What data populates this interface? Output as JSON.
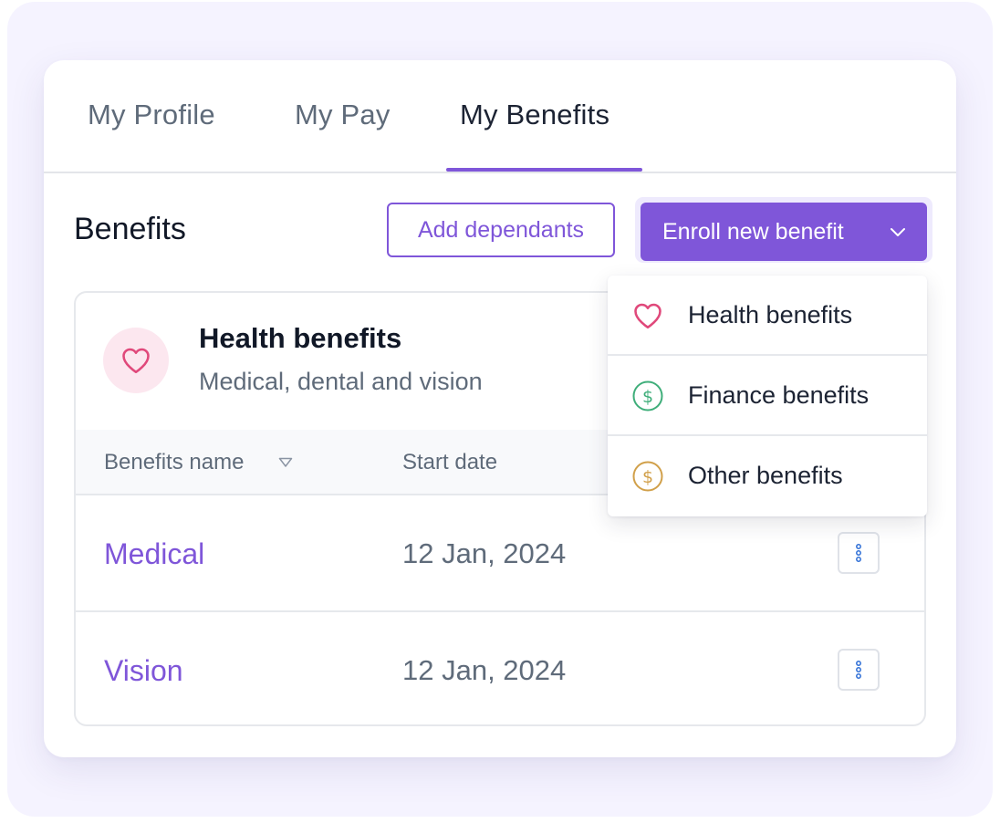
{
  "tabs": [
    {
      "label": "My Profile",
      "active": false
    },
    {
      "label": "My Pay",
      "active": false
    },
    {
      "label": "My Benefits",
      "active": true
    }
  ],
  "header": {
    "title": "Benefits",
    "add_label": "Add dependants",
    "enroll_label": "Enroll new benefit"
  },
  "category": {
    "title": "Health benefits",
    "subtitle": "Medical, dental and vision",
    "icon": "heart-icon"
  },
  "table": {
    "columns": [
      "Benefits name",
      "Start date"
    ],
    "rows": [
      {
        "name": "Medical",
        "start_date": "12 Jan, 2024"
      },
      {
        "name": "Vision",
        "start_date": "12 Jan, 2024"
      }
    ]
  },
  "menu": {
    "items": [
      {
        "label": "Health benefits",
        "icon": "heart-icon",
        "color": "#e0497b"
      },
      {
        "label": "Finance benefits",
        "icon": "dollar-circle-icon",
        "color": "#3fae7a"
      },
      {
        "label": "Other benefits",
        "icon": "dollar-circle-icon",
        "color": "#d1a04a"
      }
    ]
  },
  "colors": {
    "accent": "#7f56d9",
    "text_primary": "#111827",
    "text_secondary": "#5f6b7a"
  }
}
